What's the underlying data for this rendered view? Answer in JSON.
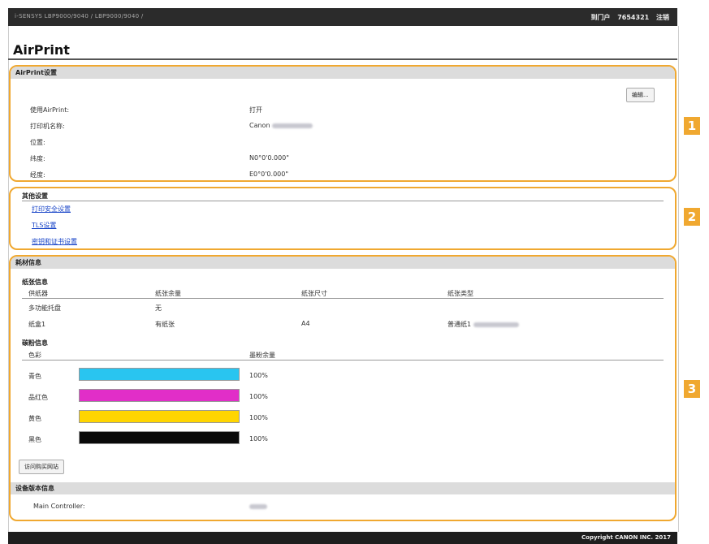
{
  "topbar": {
    "breadcrumb": "i-SENSYS    LBP9000/9040 / LBP9000/9040 /",
    "login_label": "到门户",
    "user_id": "7654321",
    "logout_label": "注销"
  },
  "page_title": "AirPrint",
  "airprint_settings": {
    "header": "AirPrint设置",
    "edit_button": "编辑...",
    "fields": [
      {
        "label": "使用AirPrint:",
        "value": "打开"
      },
      {
        "label": "打印机名称:",
        "value": "Canon"
      },
      {
        "label": "位置:",
        "value": ""
      },
      {
        "label": "纬度:",
        "value": "N0°0'0.000\""
      },
      {
        "label": "经度:",
        "value": "E0°0'0.000\""
      }
    ]
  },
  "other_settings": {
    "header": "其他设置",
    "links": [
      "打印安全设置",
      "TLS设置",
      "密钥和证书设置"
    ]
  },
  "consumables": {
    "header": "耗材信息",
    "paper": {
      "title": "纸张信息",
      "columns": [
        "供纸器",
        "纸张余量",
        "纸张尺寸",
        "纸张类型"
      ],
      "rows": [
        [
          "多功能托盘",
          "无",
          "",
          ""
        ],
        [
          "纸盒1",
          "有纸张",
          "A4",
          "普通纸1"
        ]
      ]
    },
    "toner": {
      "title": "碳粉信息",
      "col_color": "色彩",
      "col_level": "墨粉余量",
      "items": [
        {
          "name": "青色",
          "level": "100%",
          "color": "#29c5f0"
        },
        {
          "name": "品红色",
          "level": "100%",
          "color": "#e12ec8"
        },
        {
          "name": "黄色",
          "level": "100%",
          "color": "#ffd500"
        },
        {
          "name": "黑色",
          "level": "100%",
          "color": "#0a0a0a"
        }
      ]
    },
    "website_button": "访问购买网站"
  },
  "version": {
    "header": "设备版本信息",
    "label": "Main Controller:",
    "value": ""
  },
  "badges": [
    "1",
    "2",
    "3"
  ],
  "footer": "Copyright CANON INC. 2017"
}
